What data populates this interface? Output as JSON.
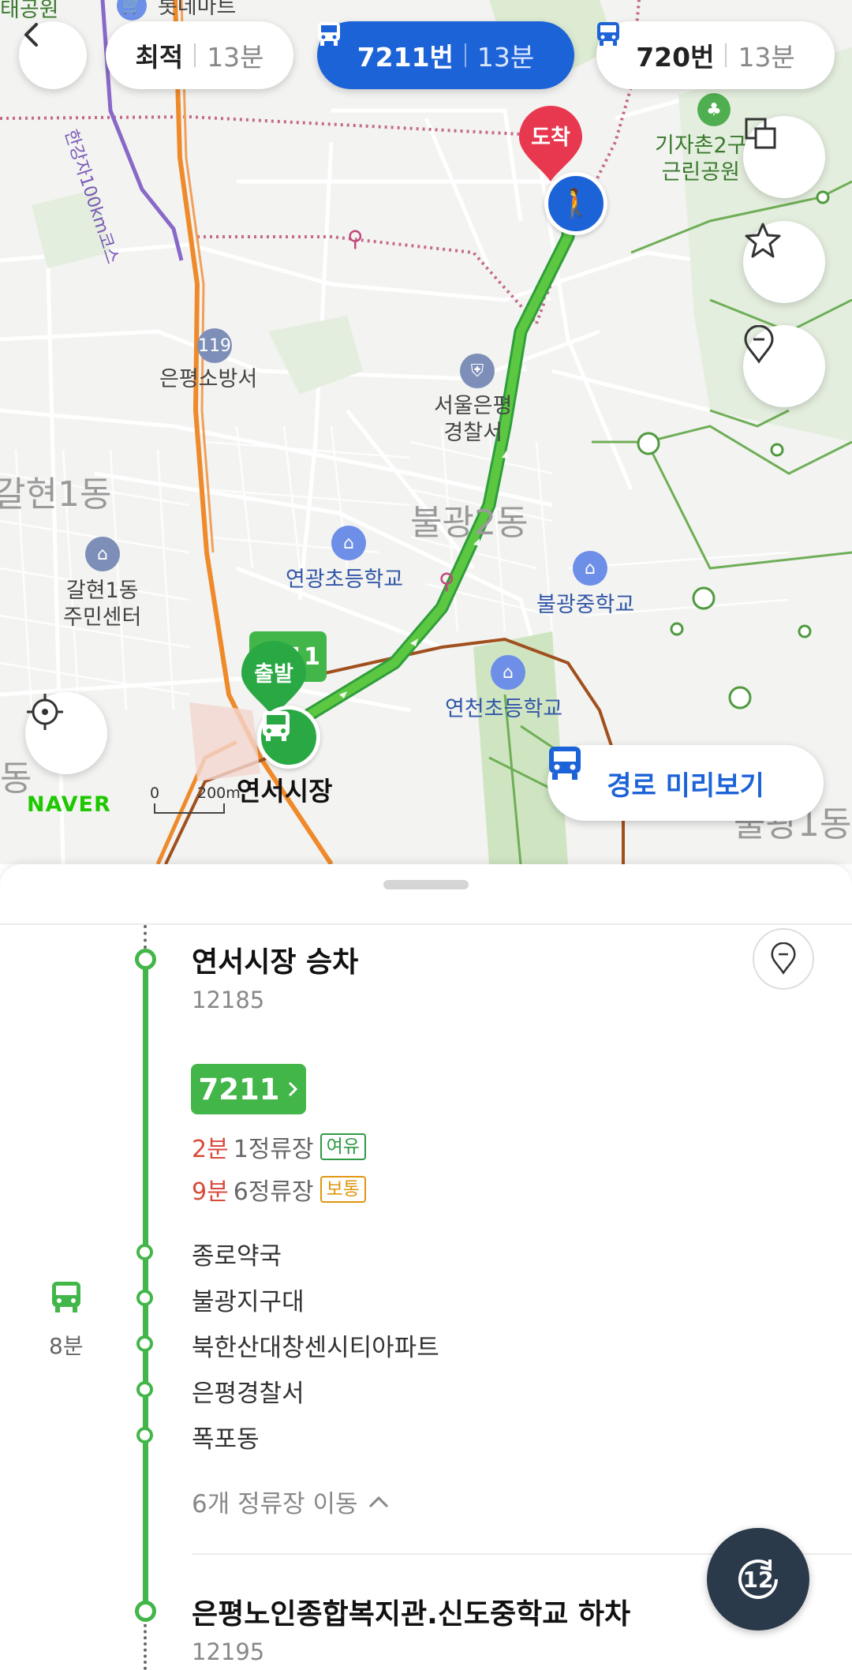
{
  "map": {
    "labels": {
      "top_left_park": "태공원",
      "lotte_mart": "롯데마트",
      "bike_course": "한강자100km코스",
      "gijachon": "기자촌2구\n근린공원",
      "fire_station": "은평소방서",
      "police": "서울은평\n경찰서",
      "galhyeon_dong": "갈현1동",
      "bulgwang2": "불광2동",
      "yeongwang_elem": "연광초등학교",
      "bulgwang_mid": "불광중학교",
      "galhyeon_center": "갈현1동\n주민센터",
      "yeoncheon_elem": "연천초등학교",
      "yeonseo_market": "연서시장",
      "bulgwang1": "불광1동",
      "left_dong": "동"
    },
    "markers": {
      "arrival": "도착",
      "departure": "출발",
      "bus_num_partial": "11"
    },
    "scale": {
      "zero": "0",
      "distance": "200m"
    },
    "naver_logo": "NAVER"
  },
  "route_tabs": [
    {
      "label": "최적",
      "time": "13분"
    },
    {
      "label": "7211번",
      "time": "13분",
      "active": true
    },
    {
      "label": "720번",
      "time": "13분"
    }
  ],
  "preview_button": {
    "label": "경로 미리보기"
  },
  "sheet": {
    "board_stop": {
      "name": "연서시장 승차",
      "id": "12185"
    },
    "bus": {
      "number": "7211"
    },
    "arrivals": [
      {
        "time": "2분",
        "stops": "1정류장",
        "status": "여유",
        "status_color": "#2e9a44"
      },
      {
        "time": "9분",
        "stops": "6정류장",
        "status": "보통",
        "status_color": "#e0960f"
      }
    ],
    "intermediate_stops": [
      "종로약국",
      "불광지구대",
      "북한산대창센시티아파트",
      "은평경찰서",
      "폭포동"
    ],
    "ride_time": "8분",
    "stop_count_toggle": "6개 정류장 이동",
    "alight_stop": {
      "name": "은평노인종합복지관.신도중학교 하차",
      "id": "12195"
    },
    "fab_number": "12"
  },
  "colors": {
    "brand_blue": "#1d63d8",
    "bus_green": "#43b64a",
    "arrival_red": "#e8384f",
    "time_red": "#d84b3b"
  }
}
